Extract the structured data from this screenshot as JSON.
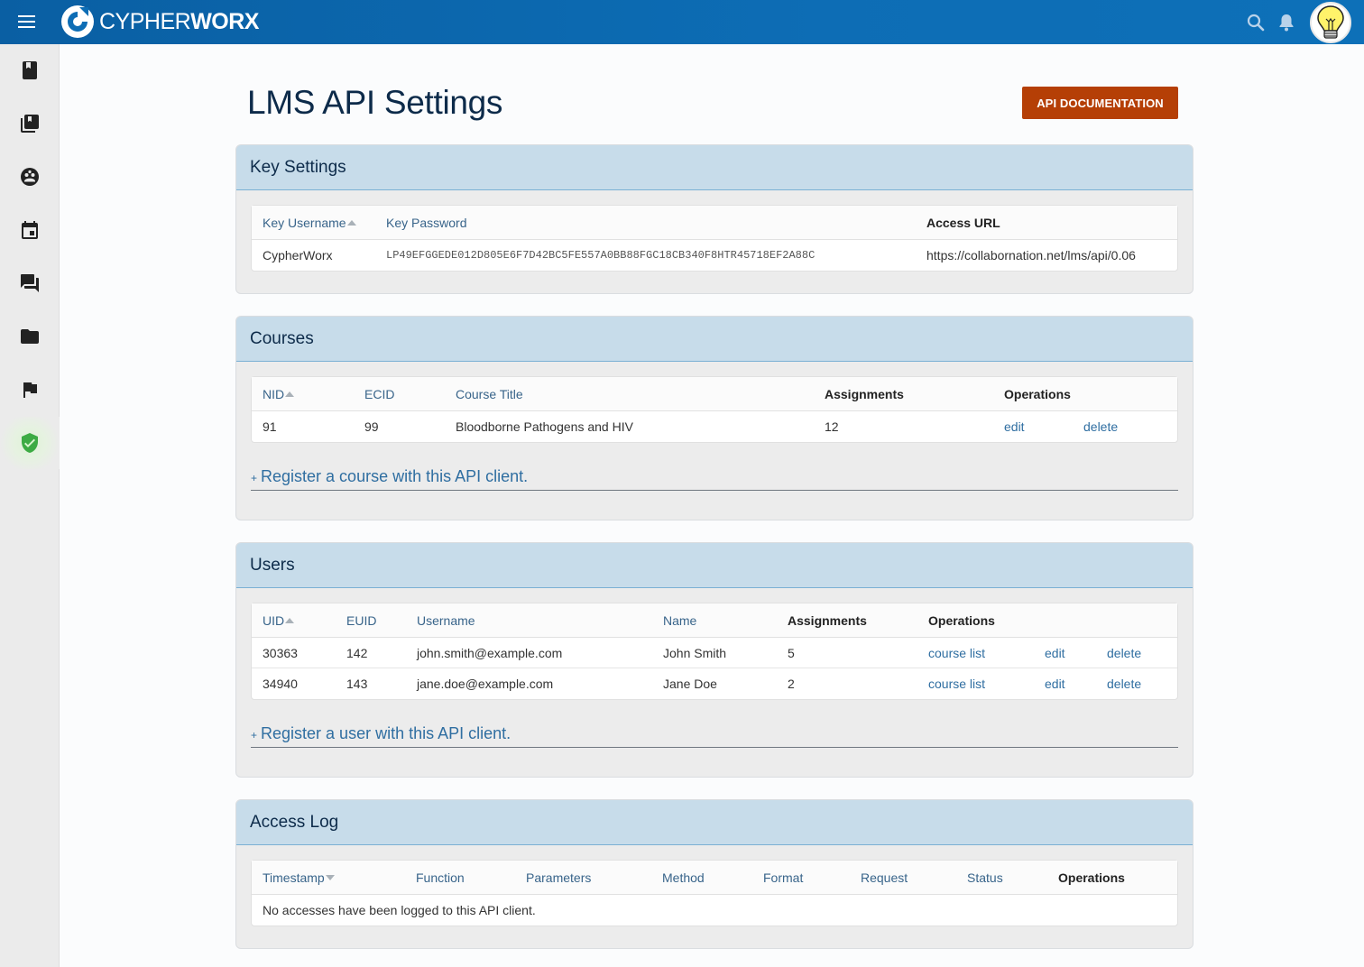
{
  "brand": {
    "prefix": "CYPHER",
    "suffix": "WORX"
  },
  "header": {
    "title": "LMS API Settings",
    "api_doc_button": "API DOCUMENTATION"
  },
  "colors": {
    "topbar": "#0d6db5",
    "accent_button": "#b53f06",
    "panel_header": "#c7dcea",
    "link": "#2f6ea1"
  },
  "sidebar": {
    "items": [
      {
        "icon": "book-icon"
      },
      {
        "icon": "library-icon"
      },
      {
        "icon": "community-icon"
      },
      {
        "icon": "calendar-icon"
      },
      {
        "icon": "forum-icon"
      },
      {
        "icon": "folder-icon"
      },
      {
        "icon": "flag-icon"
      },
      {
        "icon": "shield-check-icon",
        "active": true
      }
    ]
  },
  "key_settings": {
    "title": "Key Settings",
    "columns": [
      "Key Username",
      "Key Password",
      "Access URL"
    ],
    "row": {
      "username": "CypherWorx",
      "password": "LP49EFGGEDE012D805E6F7D42BC5FE557A0BB88FGC18CB340F8HTR45718EF2A88C",
      "url": "https://collabornation.net/lms/api/0.06"
    }
  },
  "courses": {
    "title": "Courses",
    "columns": [
      "NID",
      "ECID",
      "Course Title",
      "Assignments",
      "Operations"
    ],
    "rows": [
      {
        "nid": "91",
        "ecid": "99",
        "title": "Bloodborne Pathogens and HIV",
        "assignments": "12",
        "edit": "edit",
        "delete": "delete"
      }
    ],
    "register_plus": "+",
    "register": "Register a course with this API client."
  },
  "users": {
    "title": "Users",
    "columns": [
      "UID",
      "EUID",
      "Username",
      "Name",
      "Assignments",
      "Operations"
    ],
    "rows": [
      {
        "uid": "30363",
        "euid": "142",
        "username": "john.smith@example.com",
        "name": "John Smith",
        "assignments": "5",
        "course_list": "course list",
        "edit": "edit",
        "delete": "delete"
      },
      {
        "uid": "34940",
        "euid": "143",
        "username": "jane.doe@example.com",
        "name": "Jane Doe",
        "assignments": "2",
        "course_list": "course list",
        "edit": "edit",
        "delete": "delete"
      }
    ],
    "register_plus": "+",
    "register": "Register a user with this API client."
  },
  "access_log": {
    "title": "Access Log",
    "columns": [
      "Timestamp",
      "Function",
      "Parameters",
      "Method",
      "Format",
      "Request",
      "Status",
      "Operations"
    ],
    "empty": "No accesses have been logged to this API client."
  }
}
